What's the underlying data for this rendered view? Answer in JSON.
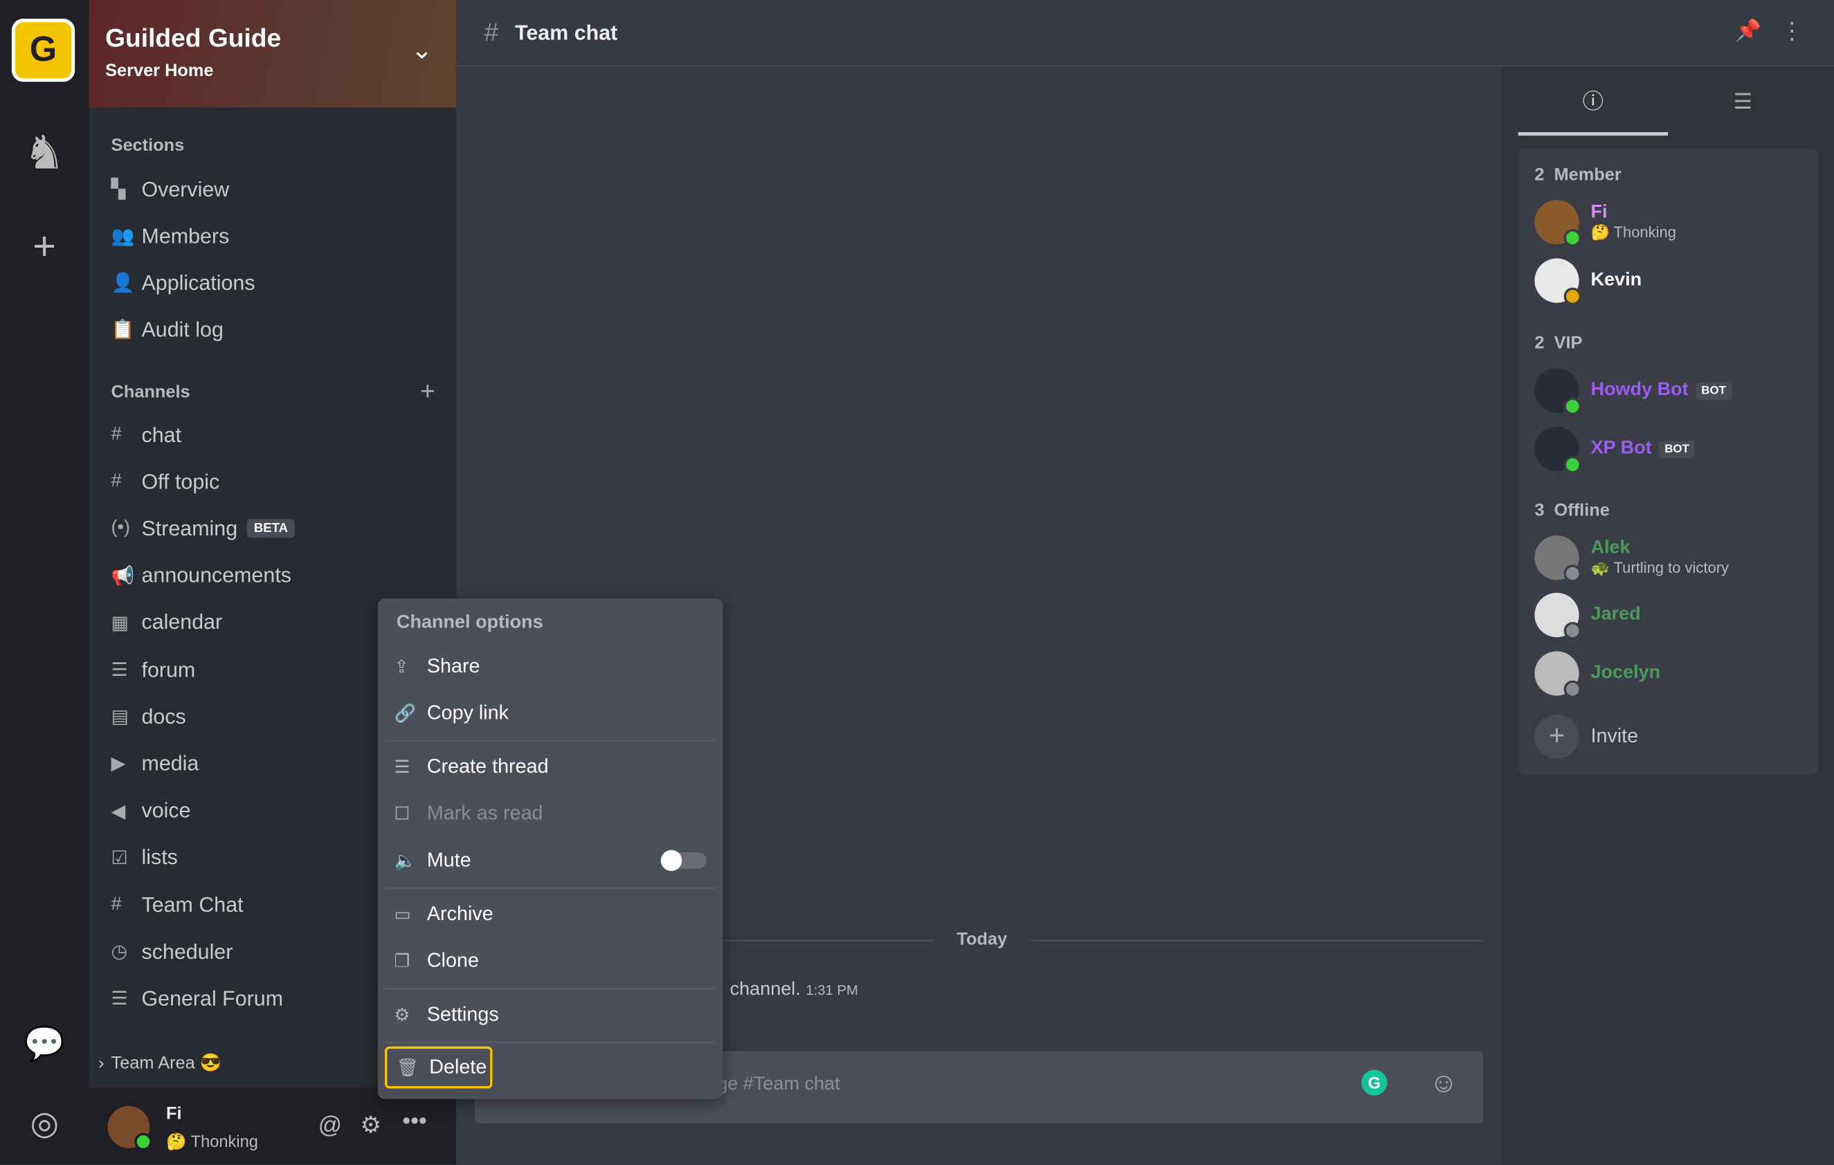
{
  "rail": {
    "logo_letter": "G",
    "icons": [
      "guilded-logo",
      "knight-avatar-icon",
      "add-server-icon",
      "chat-bubble-icon",
      "support-icon"
    ]
  },
  "server": {
    "name": "Guilded Guide",
    "subtitle": "Server Home"
  },
  "sections": {
    "label": "Sections",
    "items": [
      {
        "label": "Overview",
        "icon": "overview-icon"
      },
      {
        "label": "Members",
        "icon": "members-icon"
      },
      {
        "label": "Applications",
        "icon": "applications-icon"
      },
      {
        "label": "Audit log",
        "icon": "audit-log-icon"
      }
    ]
  },
  "channels": {
    "label": "Channels",
    "items": [
      {
        "label": "chat",
        "icon": "#"
      },
      {
        "label": "Off topic",
        "icon": "#"
      },
      {
        "label": "Streaming",
        "icon": "(•)",
        "badge": "BETA"
      },
      {
        "label": "announcements",
        "icon": "📢"
      },
      {
        "label": "calendar",
        "icon": "▦"
      },
      {
        "label": "forum",
        "icon": "☰"
      },
      {
        "label": "docs",
        "icon": "▤"
      },
      {
        "label": "media",
        "icon": "▶"
      },
      {
        "label": "voice",
        "icon": "◀"
      },
      {
        "label": "lists",
        "icon": "☑"
      },
      {
        "label": "Team Chat",
        "icon": "#"
      },
      {
        "label": "scheduler",
        "icon": "◷"
      },
      {
        "label": "General Forum",
        "icon": "☰"
      }
    ]
  },
  "team_area": {
    "label": "Team Area",
    "emoji": "😎"
  },
  "user": {
    "name": "Fi",
    "status_emoji": "🤔",
    "status": "Thonking"
  },
  "header": {
    "title": "Team chat"
  },
  "chat": {
    "divider": "Today",
    "message_text": "channel.",
    "message_time": "1:31 PM",
    "composer_placeholder": "Message #Team chat"
  },
  "menu": {
    "title": "Channel options",
    "share": "Share",
    "copy_link": "Copy link",
    "create_thread": "Create thread",
    "mark_read": "Mark as read",
    "mute": "Mute",
    "mute_on": false,
    "archive": "Archive",
    "clone": "Clone",
    "settings": "Settings",
    "delete": "Delete"
  },
  "members": {
    "groups": [
      {
        "count": "2",
        "label": "Member"
      },
      {
        "count": "2",
        "label": "VIP"
      },
      {
        "count": "3",
        "label": "Offline"
      }
    ],
    "list": [
      {
        "name": "Fi",
        "status_emoji": "🤔",
        "status": "Thonking",
        "color": "#d68bf5",
        "presence": "#3bd13b"
      },
      {
        "name": "Kevin",
        "color": "#ffffff",
        "presence": "#e6a800"
      },
      {
        "name": "Howdy Bot",
        "badge": "BOT",
        "color": "#9a5cf2",
        "presence": "#3bd13b"
      },
      {
        "name": "XP Bot",
        "badge": "BOT",
        "color": "#9a5cf2",
        "presence": "#3bd13b"
      },
      {
        "name": "Alek",
        "status_emoji": "🐢",
        "status": "Turtling to victory",
        "color": "#4a9a5e",
        "presence": "#8a8b90"
      },
      {
        "name": "Jared",
        "color": "#4a9a5e",
        "presence": "#8a8b90"
      },
      {
        "name": "Jocelyn",
        "color": "#4a9a5e",
        "presence": "#8a8b90"
      }
    ],
    "invite": "Invite"
  },
  "colors": {
    "accent": "#f5c400",
    "online": "#3bd13b",
    "grammarly": "#15c39a"
  }
}
